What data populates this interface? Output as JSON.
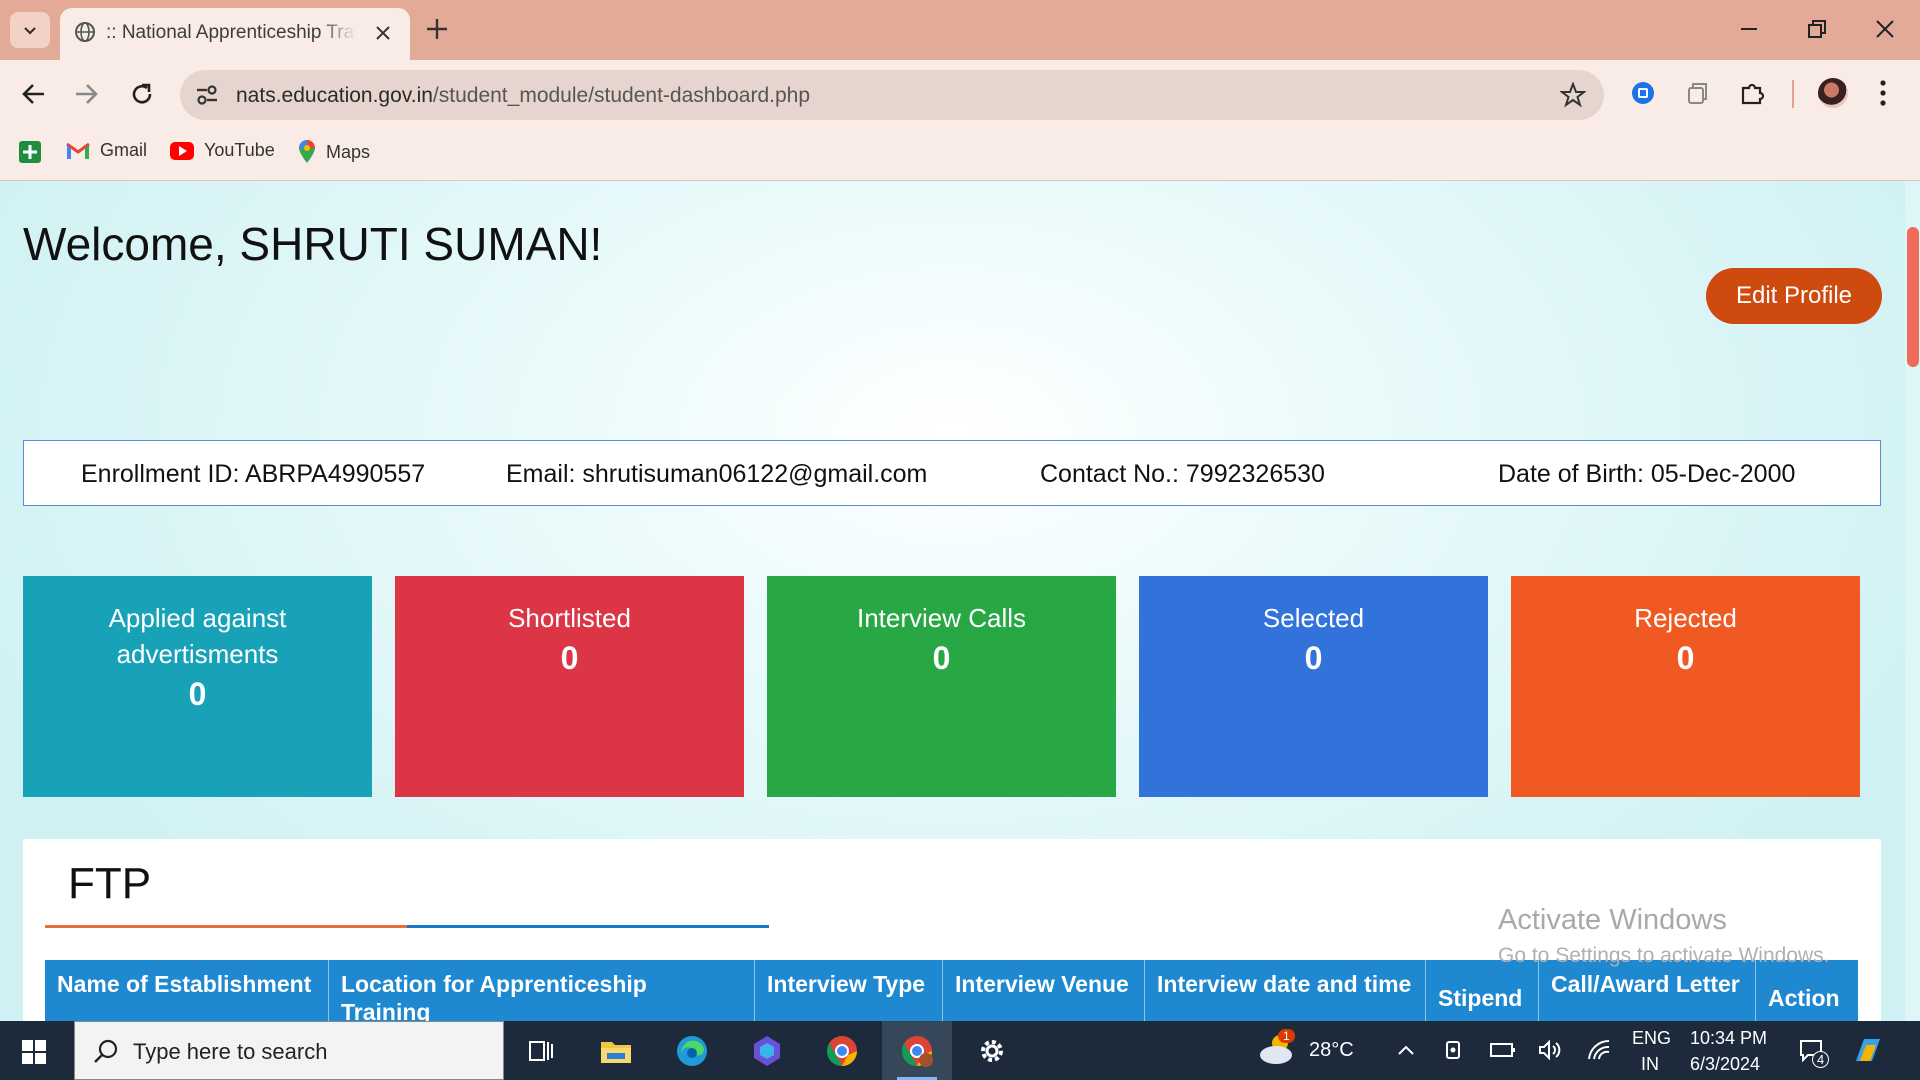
{
  "browser": {
    "tab_title": ":: National Apprenticeship Training Scheme",
    "url_host": "nats.education.gov.in",
    "url_path": "/student_module/student-dashboard.php",
    "bookmarks": [
      {
        "label": "Gmail",
        "icon": "gmail-icon"
      },
      {
        "label": "YouTube",
        "icon": "youtube-icon"
      },
      {
        "label": "Maps",
        "icon": "maps-icon"
      }
    ]
  },
  "page": {
    "welcome": "Welcome, SHRUTI SUMAN!",
    "edit_profile": "Edit Profile",
    "info": {
      "enrollment": "Enrollment ID: ABRPA4990557",
      "email": "Email: shrutisuman06122@gmail.com",
      "contact": "Contact No.: 7992326530",
      "dob": "Date of Birth: 05-Dec-2000"
    },
    "stats": [
      {
        "label": "Applied against advertisments",
        "value": "0",
        "color": "#18a2b8"
      },
      {
        "label": "Shortlisted",
        "value": "0",
        "color": "#dc3545"
      },
      {
        "label": "Interview Calls",
        "value": "0",
        "color": "#28a745"
      },
      {
        "label": "Selected",
        "value": "0",
        "color": "#3173db"
      },
      {
        "label": "Rejected",
        "value": "0",
        "color": "#f05a22"
      }
    ],
    "ftp": {
      "title": "FTP",
      "columns": [
        "Name of Establishment",
        "Location for Apprenticeship Training",
        "Interview Type",
        "Interview Venue",
        "Interview date and time",
        "Stipend",
        "Call/Award Letter",
        "Action"
      ]
    },
    "watermark": {
      "line1": "Activate Windows",
      "line2": "Go to Settings to activate Windows."
    }
  },
  "taskbar": {
    "search_placeholder": "Type here to search",
    "weather": "28°C",
    "weather_badge": "1",
    "lang_line1": "ENG",
    "lang_line2": "IN",
    "time": "10:34 PM",
    "date": "6/3/2024",
    "notification_count": "4"
  }
}
